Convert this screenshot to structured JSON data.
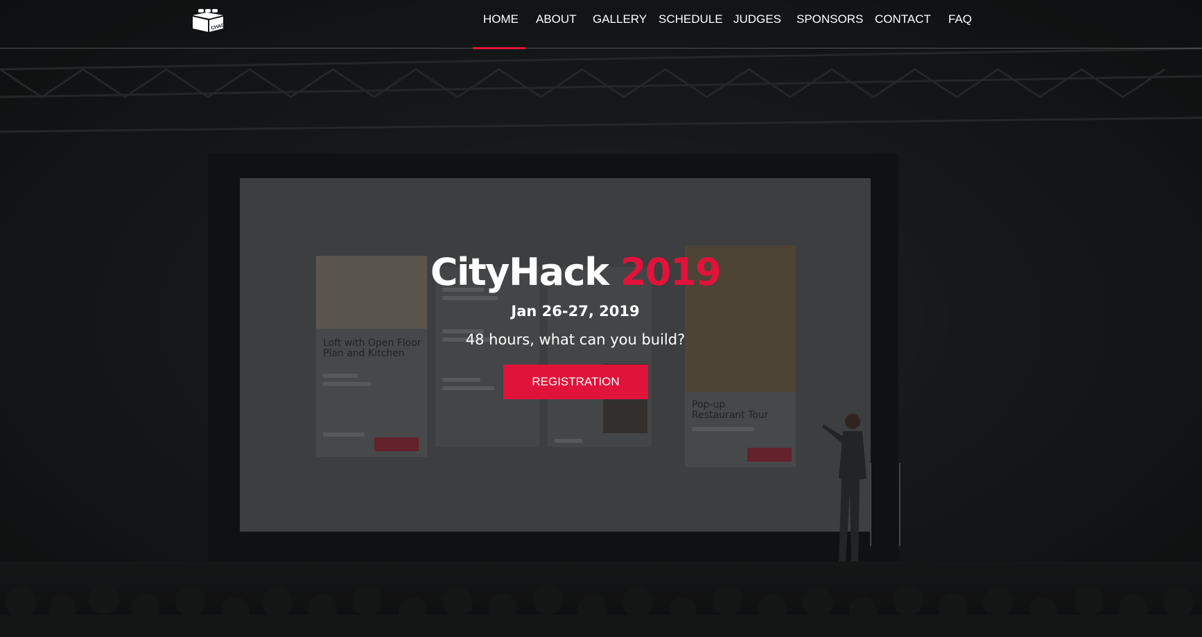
{
  "logo": {
    "text": "CHACK"
  },
  "nav": {
    "items": [
      {
        "label": "HOME",
        "active": true
      },
      {
        "label": "ABOUT",
        "active": false
      },
      {
        "label": "GALLERY",
        "active": false
      },
      {
        "label": "SCHEDULE",
        "active": false
      },
      {
        "label": "JUDGES",
        "active": false
      },
      {
        "label": "SPONSORS",
        "active": false
      },
      {
        "label": "CONTACT",
        "active": false
      },
      {
        "label": "FAQ",
        "active": false
      }
    ]
  },
  "hero": {
    "title_brand": "CityHack",
    "title_year": "2019",
    "date": "Jan 26-27, 2019",
    "tagline": "48 hours, what can you build?",
    "cta_label": "REGISTRATION"
  },
  "screen_cards": {
    "card1_title_line1": "Loft with Open Floor",
    "card1_title_line2": "Plan and Kitchen",
    "card3_title_line1": "Pop-up",
    "card3_title_line2": "Restaurant Tour"
  },
  "colors": {
    "accent": "#e0133a",
    "text": "#ffffff",
    "background": "#15181a"
  }
}
